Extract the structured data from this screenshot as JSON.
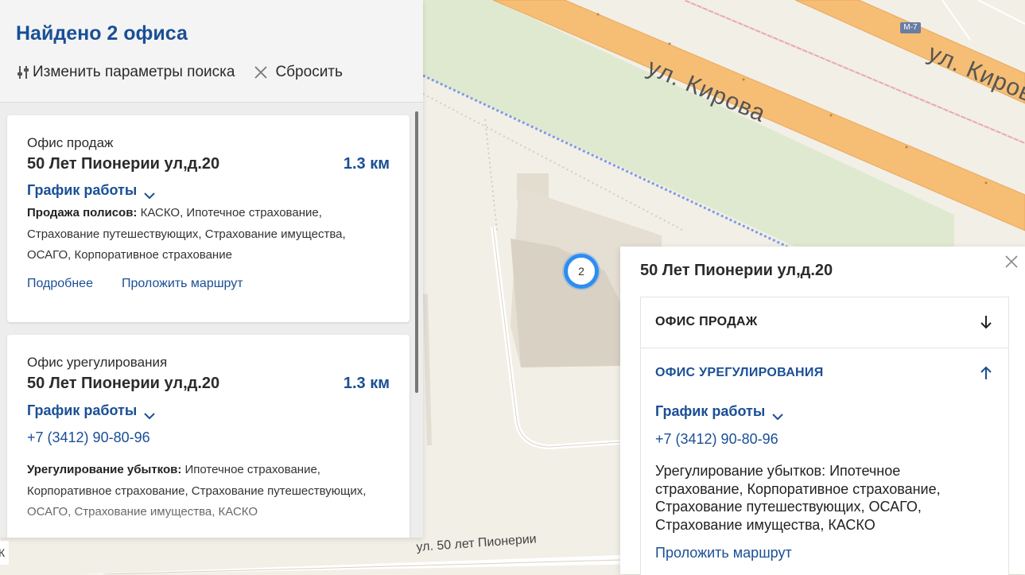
{
  "map": {
    "street_kirova_1": "ул. Кирова",
    "street_kirova_2": "ул. Кирова",
    "street_pioneer": "ул. 50 лет Пионерии",
    "highway_badge": "М-7",
    "marker_count": "2",
    "left_edge_label": "К"
  },
  "results": {
    "title": "Найдено 2 офиса",
    "change_params_label": "Изменить параметры поиска",
    "reset_label": "Сбросить",
    "offices": [
      {
        "type": "Офис продаж",
        "address": "50 Лет Пионерии ул,д.20",
        "distance": "1.3 км",
        "schedule_label": "График работы",
        "services_title": "Продажа полисов:",
        "services": " КАСКО, Ипотечное страхование, Страхование путешествующих, Страхование имущества, ОСАГО, Корпоративное страхование",
        "details_link": "Подробнее",
        "route_link": "Проложить маршрут"
      },
      {
        "type": "Офис урегулирования",
        "address": "50 Лет Пионерии ул,д.20",
        "distance": "1.3 км",
        "schedule_label": "График работы",
        "phone": "+7 (3412) 90-80-96",
        "services_title": "Урегулирование убытков:",
        "services": " Ипотечное страхование, Корпоративное страхование, Страхование путешествующих, ОСАГО, Страхование имущества, КАСКО"
      }
    ]
  },
  "popup": {
    "title": "50 Лет Пионерии ул,д.20",
    "section_sales": "ОФИС ПРОДАЖ",
    "section_settlement": "ОФИС УРЕГУЛИРОВАНИЯ",
    "schedule_label": "График работы",
    "phone": "+7 (3412) 90-80-96",
    "description": "Урегулирование убытков: Ипотечное страхование, Корпоративное страхование, Страхование путешествующих, ОСАГО, Страхование имущества, КАСКО",
    "route_link": "Проложить маршрут"
  },
  "colors": {
    "brand_blue": "#1a4f96",
    "marker_blue": "#2e8df0",
    "road_orange": "#f6be74"
  },
  "icons": [
    "filter-icon",
    "close-icon",
    "chevron-down-icon",
    "arrow-down-icon",
    "arrow-up-icon"
  ]
}
